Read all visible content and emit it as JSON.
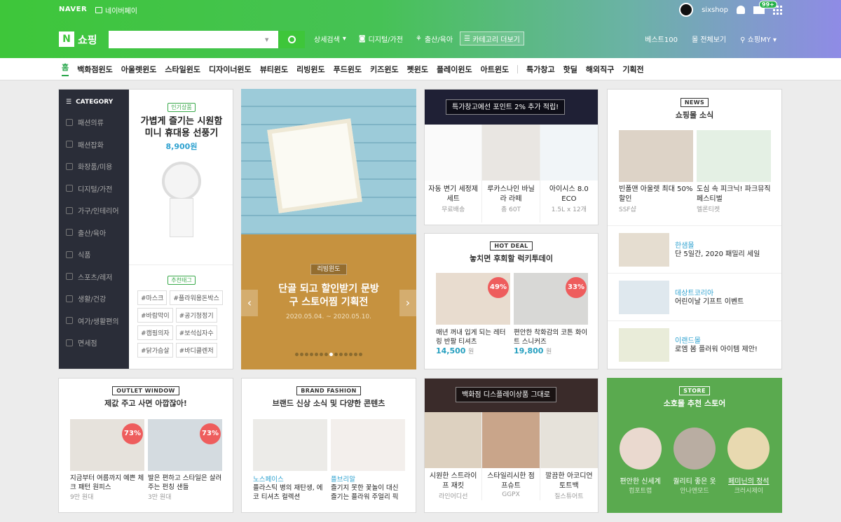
{
  "topbar": {
    "naver": "NAVER",
    "npay": "네이버페이",
    "user": "sixshop",
    "badge": "99+"
  },
  "mainbar": {
    "logo_n": "N",
    "logo": "쇼핑",
    "search_placeholder": "",
    "detail": "상세검색",
    "digital": "디지털/가전",
    "baby": "출산/육아",
    "catmore": "카테고리 더보기",
    "best": "베스트100",
    "mall": "몰 전체보기",
    "my": "쇼핑MY"
  },
  "nav": [
    "홈",
    "백화점윈도",
    "아울렛윈도",
    "스타일윈도",
    "디자이너윈도",
    "뷰티윈도",
    "리빙윈도",
    "푸드윈도",
    "키즈윈도",
    "펫윈도",
    "플레이윈도",
    "아트윈도",
    "특가창고",
    "핫딜",
    "해외직구",
    "기획전"
  ],
  "category": {
    "header": "CATEGORY",
    "items": [
      "패션의류",
      "패션잡화",
      "화장품/미용",
      "디지털/가전",
      "가구/인테리어",
      "출산/육아",
      "식품",
      "스포츠/레저",
      "생활/건강",
      "여가/생활편의",
      "면세점"
    ]
  },
  "popular": {
    "tag": "인기상품",
    "title": "가볍게 즐기는 시원함 미니 휴대용 선풍기",
    "price": "8,900원",
    "rec_tag": "추천태그",
    "tags": [
      "#마스크",
      "#플라워용돈박스",
      "#바람막이",
      "#공기청정기",
      "#캠핑의자",
      "#보석십자수",
      "#닭가슴살",
      "#바디클렌저"
    ]
  },
  "banner": {
    "tag": "리빙윈도",
    "title": "단골 되고 할인받기 문방구 스토어찜 기획전",
    "date": "2020.05.04. ~ 2020.05.10."
  },
  "special": {
    "strip": "특가창고에선 포인트 2% 추가 적립!",
    "items": [
      {
        "name": "자동 변기 세정제 세트",
        "sub": "무료배송"
      },
      {
        "name": "루카스나인 바닐라 라떼",
        "sub": "총 60T"
      },
      {
        "name": "아이시스 8.0 ECO",
        "sub": "1.5L x 12개"
      }
    ]
  },
  "news": {
    "tag": "NEWS",
    "title": "쇼핑몰 소식",
    "top": [
      {
        "name": "빈폴맨 아울렛 최대 50% 할인",
        "sub": "SSF샵"
      },
      {
        "name": "도심 속 피크닉! 파크뮤직 페스티벌",
        "sub": "멜론티켓"
      }
    ],
    "list": [
      {
        "brand": "한샘몰",
        "text": "단 5일간, 2020 패밀리 세일"
      },
      {
        "brand": "데상트코리아",
        "text": "어린이날 기프트 이벤트"
      },
      {
        "brand": "이랜드몰",
        "text": "로엠 봄 플러워 아이템 제안!"
      }
    ]
  },
  "hotdeal": {
    "tag": "HOT DEAL",
    "title": "놓치면 후회할 럭키투데이",
    "items": [
      {
        "pct": "49%",
        "name": "매년 꺼내 입게 되는 레터링 반팔 티셔츠",
        "price": "14,500",
        "unit": "원"
      },
      {
        "pct": "33%",
        "name": "편안한 착화감의 코튼 화이트 스니커즈",
        "price": "19,800",
        "unit": "원"
      }
    ]
  },
  "outlet": {
    "tag": "OUTLET WINDOW",
    "title": "제값 주고 사면 아깝잖아!",
    "items": [
      {
        "pct": "73%",
        "name": "지금부터 여름까지 예쁜 체크 패턴 원피스",
        "sub": "9만 원대"
      },
      {
        "pct": "73%",
        "name": "발은 편하고 스타일은 살려주는 펀칭 샌들",
        "sub": "3만 원대"
      }
    ]
  },
  "brand": {
    "tag": "BRAND FASHION",
    "title": "브랜드 신상 소식 및 다양한 콘텐츠",
    "items": [
      {
        "brand": "노스페이스",
        "name": "플라스틱 병의 재탄생, 에코 티셔츠 컬렉션"
      },
      {
        "brand": "플브리알",
        "name": "즐기지 못한 꽃놀이 대신 즐기는 플라워 주얼리 픽"
      }
    ]
  },
  "dept": {
    "strip": "백화점 디스플레이상품 그대로",
    "items": [
      {
        "name": "시원한 스트라이프 재킷",
        "sub": "라인어디선"
      },
      {
        "name": "스타일리시한 점프슈트",
        "sub": "GGPX"
      },
      {
        "name": "깔끔한 아코디언 토트백",
        "sub": "질스튜어트"
      }
    ]
  },
  "store": {
    "tag": "STORE",
    "title": "소호몰 추천 스토어",
    "items": [
      {
        "name": "편안한 신세계",
        "sub": "컴포트랩"
      },
      {
        "name": "퀄리티 좋은 옷",
        "sub": "안나앤모드"
      },
      {
        "name": "페미닌의 정석",
        "sub": "크러시제이"
      }
    ]
  }
}
